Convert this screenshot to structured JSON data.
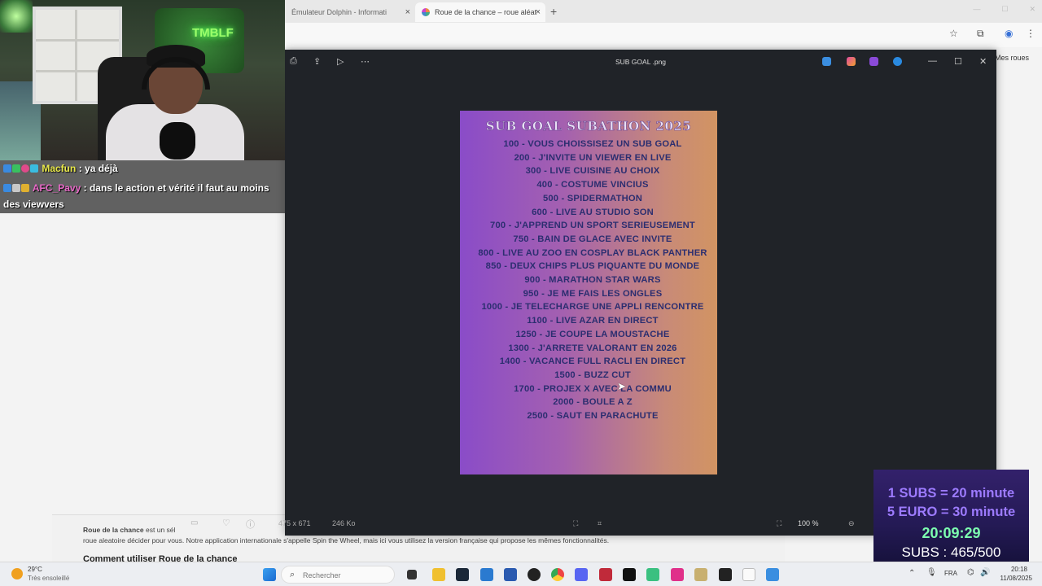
{
  "browser": {
    "tabs": [
      {
        "label": "Émulateur Dolphin - Informati",
        "active": false
      },
      {
        "label": "Roue de la chance – roue aléat",
        "active": true
      }
    ],
    "new_tab_symbol": "+",
    "page_button": "Mes roues"
  },
  "footer": {
    "brand": "Roue de la chance",
    "line1_rest": "est un sél",
    "line2": "roue aleatoire décider pour vous. Notre application internationale s'appelle Spin the Wheel, mais ici vous utilisez la version française qui propose les mêmes fonctionnalités.",
    "line3": "Comment utiliser Roue de la chance"
  },
  "viewer": {
    "filename": "SUB GOAL .png",
    "dimensions": "475 x 671",
    "filesize": "246 Ko",
    "zoom": "100 %"
  },
  "image": {
    "title": "SUB GOAL SUBATHON 2025",
    "goals": [
      "100 - VOUS CHOISSISEZ UN SUB GOAL",
      "200 - J'INVITE UN VIEWER EN LIVE",
      "300 - LIVE CUISINE AU CHOIX",
      "400 - COSTUME VINCIUS",
      "500 - SPIDERMATHON",
      "600 - LIVE AU STUDIO SON",
      "700 - J'APPREND UN SPORT SERIEUSEMENT",
      "750 - BAIN DE GLACE AVEC INVITE",
      "800 - LIVE AU ZOO EN COSPLAY BLACK PANTHER",
      "850 - DEUX CHIPS PLUS PIQUANTE DU MONDE",
      "900 - MARATHON STAR WARS",
      "950 - JE ME FAIS LES ONGLES",
      "1000 - JE TELECHARGE UNE APPLI RENCONTRE",
      "1100 - LIVE AZAR EN DIRECT",
      "1250 - JE COUPE LA MOUSTACHE",
      "1300 - J'ARRETE VALORANT EN 2026",
      "1400 - VACANCE FULL RACLI EN DIRECT",
      "1500 - BUZZ CUT",
      "1700 - PROJEX X AVEC LA COMMU",
      "2000 - BOULE A Z",
      "2500 - SAUT EN PARACHUTE"
    ]
  },
  "webcam": {
    "neon_sign": "TMBLF"
  },
  "chat": [
    {
      "user": "Macfun",
      "message": ": ya déjà",
      "color": "#e8e84a"
    },
    {
      "user": "AFC_Pavy",
      "message": ": dans le action et vérité il faut au moins des viewvers",
      "color": "#e86ac8"
    }
  ],
  "overlay": {
    "rate1": "1 SUBS = 20 minute",
    "rate2": "5 EURO = 30 minute",
    "timer": "20:09:29",
    "subs": "SUBS : 465/500",
    "colors": {
      "rate": "#9d7bff",
      "timer": "#7dffb0",
      "subs": "#ffffff"
    }
  },
  "taskbar": {
    "weather_temp": "29°C",
    "weather_desc": "Très ensoleillé",
    "search_placeholder": "Rechercher",
    "lang": "FRA",
    "time": "20:18",
    "date": "11/08/2025"
  }
}
